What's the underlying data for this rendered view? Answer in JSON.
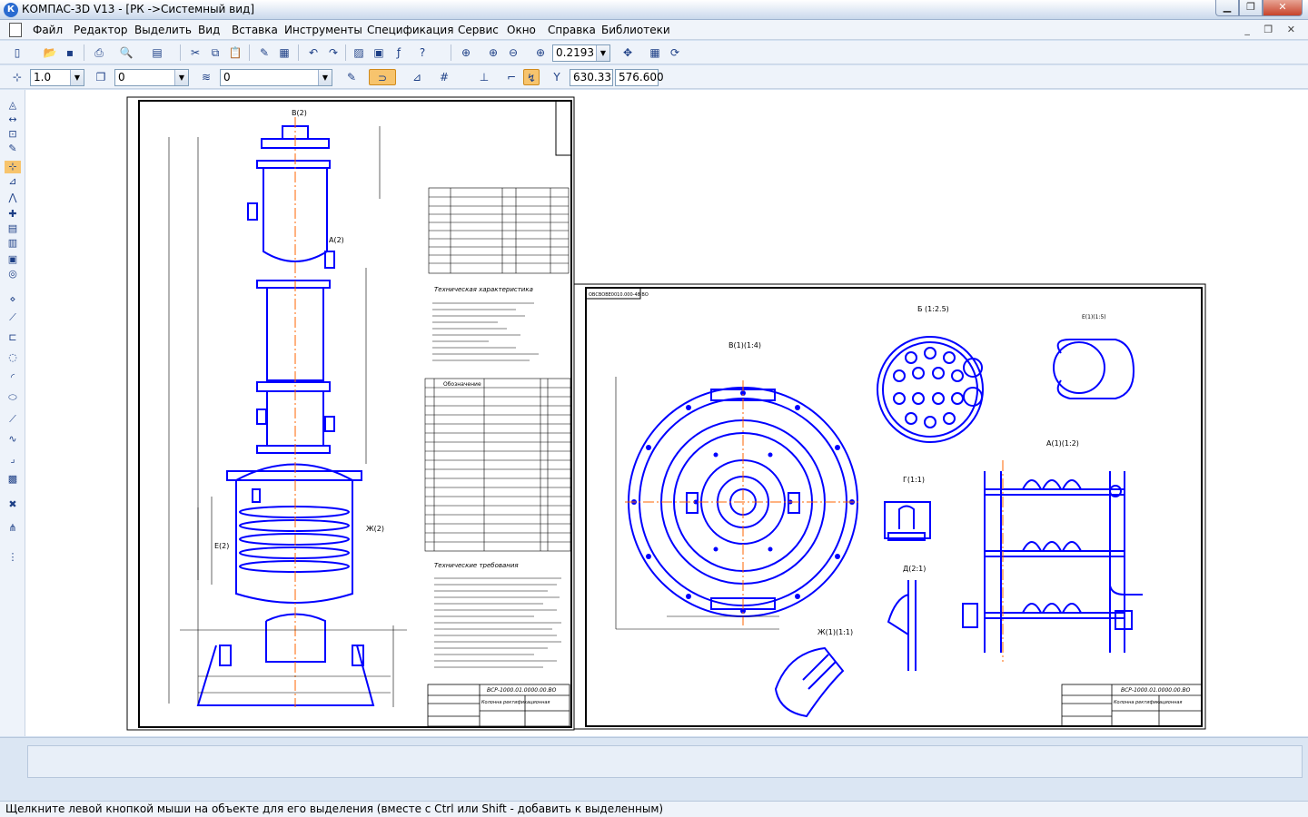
{
  "window": {
    "title": "КОМПАС-3D V13 - [РК ->Системный вид]"
  },
  "menu": [
    {
      "label": "Файл"
    },
    {
      "label": "Редактор"
    },
    {
      "label": "Выделить"
    },
    {
      "label": "Вид"
    },
    {
      "label": "Вставка"
    },
    {
      "label": "Инструменты"
    },
    {
      "label": "Спецификация"
    },
    {
      "label": "Сервис"
    },
    {
      "label": "Окно"
    },
    {
      "label": "Справка"
    },
    {
      "label": "Библиотеки"
    }
  ],
  "toolbar": {
    "zoom_value": "0.2193"
  },
  "toolbar2": {
    "step_value": "1.0",
    "layer_value": "0",
    "style_value": "0",
    "coord_x": "630.33",
    "coord_y": "576.600"
  },
  "drawing": {
    "sheet1_code": "ВСР-1000.01.0000.00.ВО",
    "sheet2_code": "ВСР-1000.01.0000.00.ВО",
    "sheet1_title": "Колонна ректификационная",
    "sheet2_title": "Колонна ректификационная",
    "sheet2_stamp": "ОВСВОВЕ0010.000-48 ВО",
    "view_labels": [
      "В(2)",
      "А(2)",
      "Е(2)",
      "Ж(2)",
      "Б (1:2.5)",
      "В(1)(1:4)",
      "Е(1)(1:5)",
      "А(1)(1:2)",
      "Г(1:1)",
      "Д(2:1)",
      "Ж(1)(1:1)"
    ],
    "tech_char_title": "Техническая характеристика",
    "tech_req_title": "Технические требования",
    "spec_header": "Обозначение"
  },
  "colors": {
    "drawing_blue": "#0000ff",
    "drawing_black": "#000000",
    "accent_orange": "#ff6600"
  },
  "status": {
    "hint": "Щелкните левой кнопкой мыши на объекте для его выделения (вместе с Ctrl или Shift - добавить к выделенным)"
  }
}
